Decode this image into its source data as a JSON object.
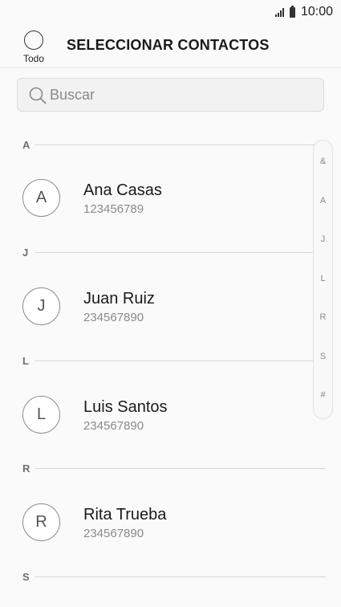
{
  "status_bar": {
    "time": "10:00"
  },
  "header": {
    "select_all_label": "Todo",
    "title": "SELECCIONAR CONTACTOS"
  },
  "search": {
    "placeholder": "Buscar",
    "value": ""
  },
  "sections": [
    {
      "letter": "A",
      "contacts": [
        {
          "initial": "A",
          "name": "Ana Casas",
          "number": "123456789"
        }
      ]
    },
    {
      "letter": "J",
      "contacts": [
        {
          "initial": "J",
          "name": "Juan Ruiz",
          "number": "234567890"
        }
      ]
    },
    {
      "letter": "L",
      "contacts": [
        {
          "initial": "L",
          "name": "Luis Santos",
          "number": "234567890"
        }
      ]
    },
    {
      "letter": "R",
      "contacts": [
        {
          "initial": "R",
          "name": "Rita Trueba",
          "number": "234567890"
        }
      ]
    },
    {
      "letter": "S",
      "contacts": []
    }
  ],
  "index": [
    "&",
    "A",
    "J",
    "L",
    "R",
    "S",
    "#"
  ]
}
